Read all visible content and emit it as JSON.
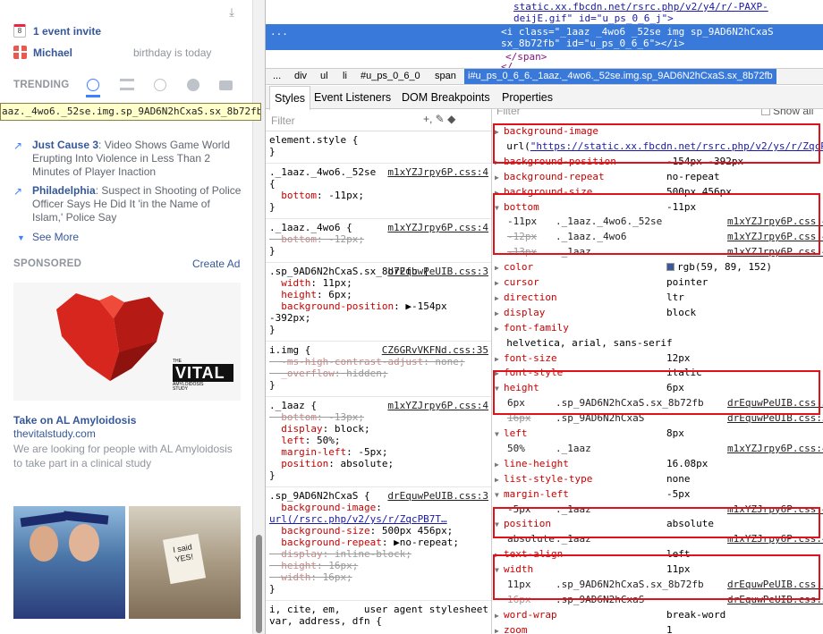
{
  "facebook": {
    "event_invite": "1 event invite",
    "birthday_name": "Michael",
    "birthday_text": "birthday is today",
    "trending_label": "TRENDING",
    "tooltip": "aaz._4wo6._52se.img.sp_9AD6N2hCxaS.sx_8b72fb",
    "trends": [
      {
        "title": "Just Cause 3",
        "text": ": Video Shows Game World Erupting Into Violence in Less Than 2 Minutes of Player Inaction"
      },
      {
        "title": "Philadelphia",
        "text": ": Suspect in Shooting of Police Officer Says He Did It 'in the Name of Islam,' Police Say"
      }
    ],
    "see_more": "See More",
    "sponsored_label": "SPONSORED",
    "create_ad": "Create Ad",
    "ad_logo_top": "THE",
    "ad_logo_main": "VITAL",
    "ad_logo_sub1": "AMYLOIDOSIS",
    "ad_logo_sub2": "STUDY",
    "ad_title": "Take on AL Amyloidosis",
    "ad_url": "thevitalstudy.com",
    "ad_desc": "We are looking for people with AL Amyloidosis to take part in a clinical study",
    "calendar_day": "8",
    "photo2_sign": "I said YES!"
  },
  "devtools": {
    "source_lines": [
      "static.xx.fbcdn.net/rsrc.php/v2/y4/r/-PAXP-",
      "deijE.gif\" id=\"u_ps_0_6_j\">",
      "<i class=\"_1aaz _4wo6 _52se  img sp_9AD6N2hCxaS",
      "sx_8b72fb\" id=\"u_ps_0_6_6\"></i>",
      "</span>",
      "</..."
    ],
    "ellipsis": "...",
    "breadcrumbs": [
      "...",
      "div",
      "ul",
      "li",
      "#u_ps_0_6_0",
      "span"
    ],
    "breadcrumb_selected": "i#u_ps_0_6_6._1aaz._4wo6._52se.img.sp_9AD6N2hCxaS.sx_8b72fb",
    "tabs": [
      "Styles",
      "Event Listeners",
      "DOM Breakpoints",
      "Properties"
    ],
    "filter_placeholder": "Filter",
    "show_all": "Show all",
    "filter_icons": "+, ✎ ◆",
    "rules": [
      {
        "selector": "element.style {",
        "source": "",
        "lines": [],
        "close": "}"
      },
      {
        "selector": "._1aaz._4wo6._52se",
        "source": "m1xYZJrpy6P.css:4",
        "lines": [
          {
            "t": "{",
            "s": false
          },
          {
            "p": "bottom",
            "v": "-11px;",
            "s": false
          }
        ],
        "close": "}"
      },
      {
        "selector": "._1aaz._4wo6 {",
        "source": "m1xYZJrpy6P.css:4",
        "lines": [
          {
            "p": "bottom",
            "v": "-12px;",
            "s": true
          }
        ],
        "close": "}"
      },
      {
        "selector": ".sp_9AD6N2hCxaS.sx_8b72fb {",
        "source": "drEquwPeUIB.css:3",
        "lines": [
          {
            "p": "width",
            "v": "11px;",
            "s": false
          },
          {
            "p": "height",
            "v": "6px;",
            "s": false
          },
          {
            "p": "background-position",
            "v": "▶-154px",
            "s": false
          },
          {
            "t": "    -392px;",
            "s": false
          }
        ],
        "close": "}"
      },
      {
        "selector": "i.img {",
        "source": "CZ6GRvVKFNd.css:35",
        "lines": [
          {
            "p": "-ms-high-contrast-adjust",
            "v": "none;",
            "s": true
          },
          {
            "p": "_overflow",
            "v": "hidden;",
            "s": true
          }
        ],
        "close": "}"
      },
      {
        "selector": "._1aaz {",
        "source": "m1xYZJrpy6P.css:4",
        "lines": [
          {
            "p": "bottom",
            "v": "-13px;",
            "s": true
          },
          {
            "p": "display",
            "v": "block;",
            "s": false
          },
          {
            "p": "left",
            "v": "50%;",
            "s": false
          },
          {
            "p": "margin-left",
            "v": "-5px;",
            "s": false
          },
          {
            "p": "position",
            "v": "absolute;",
            "s": false
          }
        ],
        "close": "}"
      },
      {
        "selector": ".sp_9AD6N2hCxaS {",
        "source": "drEquwPeUIB.css:3",
        "lines": [
          {
            "p": "background-image",
            "v": "",
            "s": false
          },
          {
            "t": "    url(/rsrc.php/v2/ys/r/ZqcPB7T…",
            "s": false,
            "link": true
          },
          {
            "p": "background-size",
            "v": "500px 456px;",
            "s": false
          },
          {
            "p": "background-repeat",
            "v": "▶no-repeat;",
            "s": false
          },
          {
            "p": "display",
            "v": "inline-block;",
            "s": true
          },
          {
            "p": "height",
            "v": "16px;",
            "s": true
          },
          {
            "p": "width",
            "v": "16px;",
            "s": true
          }
        ],
        "close": "}"
      }
    ],
    "user_agent_selector": "i, cite, em,",
    "user_agent_selector2": "var, address, dfn {",
    "user_agent_label": "user agent stylesheet",
    "computed": [
      {
        "n": "background-image",
        "v": "",
        "open": false
      },
      {
        "n": "",
        "v": "url(\"https://static.xx.fbcdn.net/rsrc.php/v2/ys/r/ZqcPB7T",
        "open": null
      },
      {
        "n": "background-position",
        "v": "-154px -392px",
        "open": false
      },
      {
        "n": "background-repeat",
        "v": "no-repeat",
        "open": false
      },
      {
        "n": "background-size",
        "v": "500px 456px",
        "open": false
      },
      {
        "n": "bottom",
        "v": "-11px",
        "open": true,
        "subs": [
          [
            "-11px",
            "._1aaz._4wo6._52se",
            "m1xYZJrpy6P.css:4",
            false
          ],
          [
            "-12px",
            "._1aaz._4wo6",
            "m1xYZJrpy6P.css:4",
            true
          ],
          [
            "-13px",
            "._1aaz",
            "m1xYZJrpy6P.css:4",
            true
          ]
        ]
      },
      {
        "n": "color",
        "v": "rgb(59, 89, 152)",
        "open": false,
        "swatch": "#3b5998"
      },
      {
        "n": "cursor",
        "v": "pointer",
        "open": false
      },
      {
        "n": "direction",
        "v": "ltr",
        "open": false
      },
      {
        "n": "display",
        "v": "block",
        "open": false
      },
      {
        "n": "font-family",
        "v": "",
        "open": false
      },
      {
        "n": "",
        "v": "helvetica, arial, sans-serif",
        "open": null
      },
      {
        "n": "font-size",
        "v": "12px",
        "open": false
      },
      {
        "n": "font-style",
        "v": "italic",
        "open": false
      },
      {
        "n": "height",
        "v": "6px",
        "open": true,
        "subs": [
          [
            "6px",
            ".sp_9AD6N2hCxaS.sx_8b72fb",
            "drEquwPeUIB.css:3",
            false
          ],
          [
            "16px",
            ".sp_9AD6N2hCxaS",
            "drEquwPeUIB.css:3",
            true
          ]
        ]
      },
      {
        "n": "left",
        "v": "8px",
        "open": true,
        "subs": [
          [
            "50%",
            "._1aaz",
            "m1xYZJrpy6P.css:4",
            false
          ]
        ]
      },
      {
        "n": "line-height",
        "v": "16.08px",
        "open": false
      },
      {
        "n": "list-style-type",
        "v": "none",
        "open": false
      },
      {
        "n": "margin-left",
        "v": "-5px",
        "open": true,
        "subs": [
          [
            "-5px",
            "._1aaz",
            "m1xYZJrpy6P.css:4",
            false
          ]
        ]
      },
      {
        "n": "position",
        "v": "absolute",
        "open": true,
        "subs": [
          [
            "absolute",
            "._1aaz",
            "m1xYZJrpy6P.css:4",
            false
          ]
        ]
      },
      {
        "n": "text-align",
        "v": "left",
        "open": false
      },
      {
        "n": "width",
        "v": "11px",
        "open": true,
        "subs": [
          [
            "11px",
            ".sp_9AD6N2hCxaS.sx_8b72fb",
            "drEquwPeUIB.css:3",
            false
          ],
          [
            "16px",
            ".sp_9AD6N2hCxaS",
            "drEquwPeUIB.css:3",
            true
          ]
        ]
      },
      {
        "n": "word-wrap",
        "v": "break-word",
        "open": false
      },
      {
        "n": "zoom",
        "v": "1",
        "open": false
      }
    ]
  },
  "colors": {
    "fb_link": "#365899",
    "devtools_select": "#3879d9",
    "highlight_box": "#e1111a"
  }
}
